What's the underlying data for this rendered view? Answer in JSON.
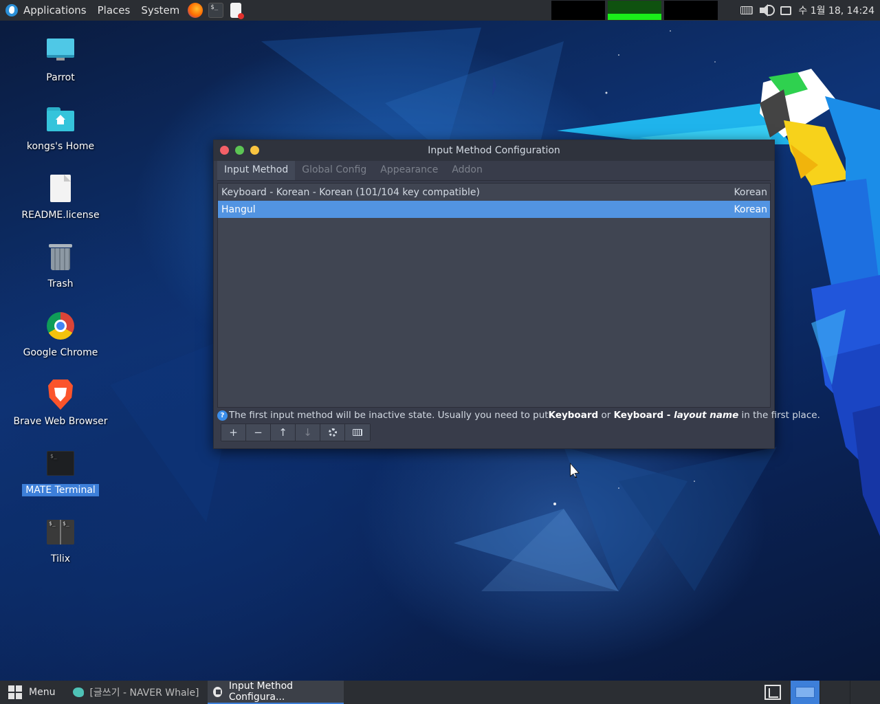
{
  "top_panel": {
    "menus": [
      "Applications",
      "Places",
      "System"
    ],
    "clock": "수 1월 18, 14:24"
  },
  "desktop_icons": [
    {
      "label": "Parrot"
    },
    {
      "label": "kongs's Home"
    },
    {
      "label": "README.license"
    },
    {
      "label": "Trash"
    },
    {
      "label": "Google Chrome"
    },
    {
      "label": "Brave Web Browser"
    },
    {
      "label": "MATE Terminal",
      "selected": true
    },
    {
      "label": "Tilix"
    }
  ],
  "dialog": {
    "title": "Input Method Configuration",
    "tabs": [
      "Input Method",
      "Global Config",
      "Appearance",
      "Addon"
    ],
    "active_tab": "Input Method",
    "input_methods": [
      {
        "name": "Keyboard - Korean - Korean (101/104 key compatible)",
        "language": "Korean"
      },
      {
        "name": "Hangul",
        "language": "Korean",
        "selected": true
      }
    ],
    "hint": {
      "icon": "?",
      "part1": "The first input method will be inactive state. Usually you need to put ",
      "keyboard": "Keyboard",
      "or": " or ",
      "keyboard2": "Keyboard - ",
      "layout_name": "layout name",
      "part2": " in the first place."
    },
    "toolbar": {
      "add": "+",
      "remove": "−",
      "up": "↑",
      "down": "↓"
    }
  },
  "bottom_panel": {
    "menu_label": "Menu",
    "tasks": [
      {
        "label": "[글쓰기 - NAVER Whale]",
        "active": false
      },
      {
        "label": "Input Method Configura...",
        "active": true
      }
    ]
  },
  "colors": {
    "accent": "#5294e2",
    "panel": "#2b2e33",
    "dialog_bg": "#383c4a"
  }
}
